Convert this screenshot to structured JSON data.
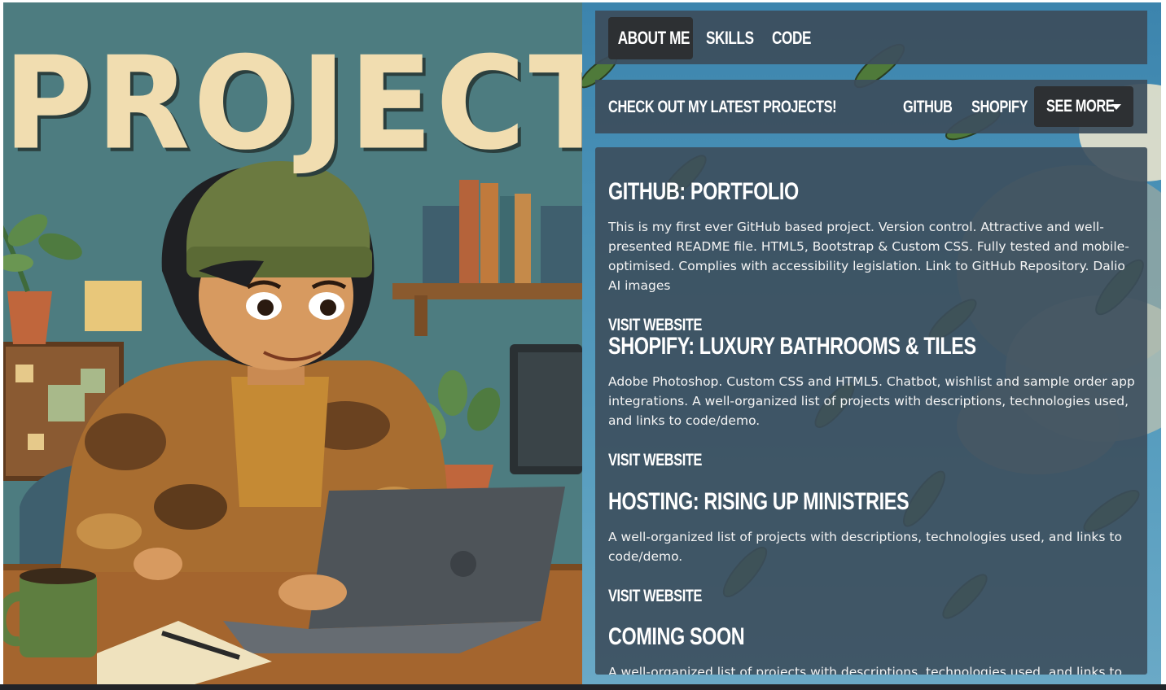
{
  "hero": {
    "title": "PROJECTS"
  },
  "nav": {
    "items": [
      {
        "label": "About Me",
        "active": true
      },
      {
        "label": "Skills",
        "active": false
      },
      {
        "label": "Code",
        "active": false
      }
    ]
  },
  "subnav": {
    "brand": "Check out my latest projects!",
    "links": [
      "GitHub",
      "Shopify"
    ],
    "dropdown_label": "See More"
  },
  "projects": [
    {
      "title": "GitHub: Portfolio",
      "description": "This is my first ever GitHub based project. Version control. Attractive and well-presented README file. HTML5, Bootstrap & Custom CSS. Fully tested and mobile-optimised. Complies with accessibility legislation. Link to GitHub Repository. Dalio AI images",
      "link_label": "Visit Website"
    },
    {
      "title": "Shopify: Luxury Bathrooms & Tiles",
      "description": "Adobe Photoshop. Custom CSS and HTML5. Chatbot, wishlist and sample order app integrations. A well-organized list of projects with descriptions, technologies used, and links to code/demo.",
      "link_label": "Visit Website"
    },
    {
      "title": "Hosting: Rising Up Ministries",
      "description": "A well-organized list of projects with descriptions, technologies used, and links to code/demo.",
      "link_label": "Visit Website"
    },
    {
      "title": "Coming Soon",
      "description": "A well-organized list of projects with descriptions, technologies used, and links to",
      "link_label": ""
    }
  ],
  "colors": {
    "panel": "#3c4e5c",
    "active_nav": "#2d3033",
    "text": "#ffffff",
    "hero_text": "#f1ddb0",
    "sky": "#4b93b8"
  }
}
